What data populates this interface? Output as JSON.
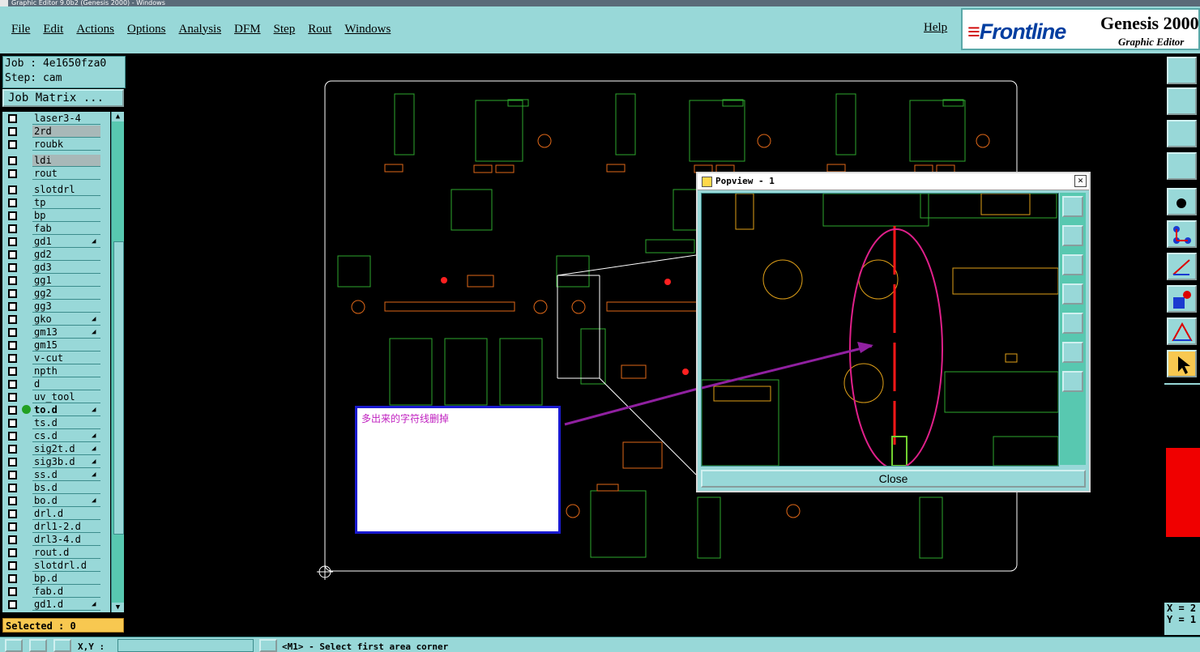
{
  "titlebar": {
    "text": "Graphic Editor 9.0b2 (Genesis 2000) - Windows"
  },
  "menu": {
    "items": [
      "File",
      "Edit",
      "Actions",
      "Options",
      "Analysis",
      "DFM",
      "Step",
      "Rout",
      "Windows"
    ],
    "help": "Help"
  },
  "brand": {
    "logo": "Frontline",
    "product": "Genesis 2000",
    "subtitle": "Graphic Editor"
  },
  "job": {
    "job_line": "Job : 4e1650fza0",
    "step_line": "Step: cam",
    "matrix_button": "Job Matrix ..."
  },
  "layers": [
    {
      "name": "laser3-4"
    },
    {
      "name": "2rd",
      "selected": true
    },
    {
      "name": "roubk",
      "gap": true
    },
    {
      "name": "ldi",
      "selected": true
    },
    {
      "name": "rout",
      "light": true,
      "gap": true
    },
    {
      "name": "slotdrl"
    },
    {
      "name": "tp"
    },
    {
      "name": "bp"
    },
    {
      "name": "fab"
    },
    {
      "name": "gd1",
      "flag": true
    },
    {
      "name": "gd2"
    },
    {
      "name": "gd3"
    },
    {
      "name": "gg1"
    },
    {
      "name": "gg2"
    },
    {
      "name": "gg3"
    },
    {
      "name": "gko",
      "flag": true
    },
    {
      "name": "gm13",
      "flag": true
    },
    {
      "name": "gm15"
    },
    {
      "name": "v-cut"
    },
    {
      "name": "npth"
    },
    {
      "name": "d"
    },
    {
      "name": "uv_tool"
    },
    {
      "name": "to.d",
      "flag": true,
      "active": true
    },
    {
      "name": "ts.d"
    },
    {
      "name": "cs.d",
      "flag": true
    },
    {
      "name": "sig2t.d",
      "flag": true
    },
    {
      "name": "sig3b.d",
      "flag": true
    },
    {
      "name": "ss.d",
      "flag": true
    },
    {
      "name": "bs.d"
    },
    {
      "name": "bo.d",
      "flag": true
    },
    {
      "name": "drl.d"
    },
    {
      "name": "drl1-2.d"
    },
    {
      "name": "drl3-4.d"
    },
    {
      "name": "rout.d"
    },
    {
      "name": "slotdrl.d"
    },
    {
      "name": "bp.d"
    },
    {
      "name": "fab.d"
    },
    {
      "name": "gd1.d",
      "flag": true
    }
  ],
  "selected": "Selected : 0",
  "note": {
    "text": "多出来的字符线删掉"
  },
  "popview": {
    "title": "Popview - 1",
    "close_label": "Close"
  },
  "coords": {
    "x": "X = 2",
    "y": "Y = 1"
  },
  "statusbar": {
    "xy_label": "X,Y :",
    "message": "<M1> - Select first area corner"
  },
  "colors": {
    "panel": "#98d8d8",
    "accent": "#58c8b0",
    "highlight": "#f8c850",
    "annotation": "#c020c0"
  }
}
